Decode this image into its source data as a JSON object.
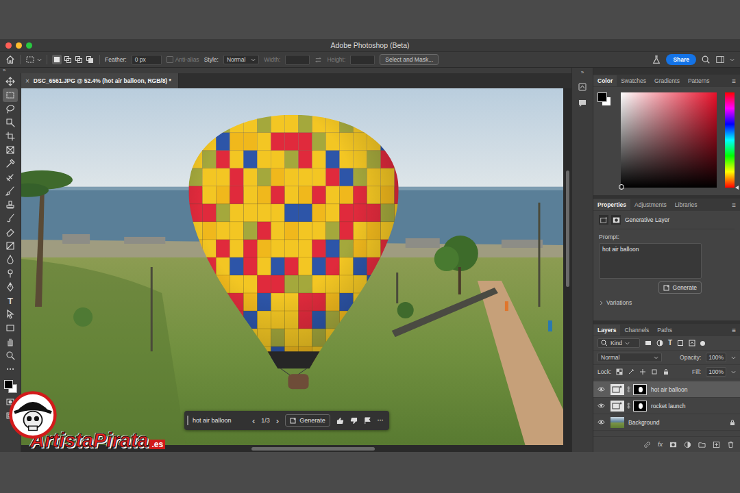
{
  "window": {
    "title": "Adobe Photoshop (Beta)"
  },
  "options_bar": {
    "feather_label": "Feather:",
    "feather_value": "0 px",
    "anti_alias": {
      "label": "Anti-alias",
      "checked": false,
      "disabled": true
    },
    "style_label": "Style:",
    "style_value": "Normal",
    "width_label": "Width:",
    "height_label": "Height:",
    "size_disabled": true,
    "select_and_mask": "Select and Mask...",
    "share": "Share",
    "selection_modes": [
      {
        "selected": true
      },
      {
        "selected": false
      },
      {
        "selected": false
      },
      {
        "selected": false
      }
    ]
  },
  "panel_collapse": "»",
  "panel_menu": "≡",
  "document": {
    "tab_title": "DSC_6561.JPG @ 52.4% (hot air balloon, RGB/8) *",
    "close": "×"
  },
  "tools": [
    {
      "selected": false
    },
    {
      "selected": true
    },
    {
      "selected": false
    },
    {
      "selected": false
    },
    {
      "selected": false
    },
    {
      "selected": false
    },
    {
      "selected": false
    },
    {
      "selected": false
    },
    {
      "selected": false
    },
    {
      "selected": false
    },
    {
      "selected": false
    },
    {
      "selected": false
    },
    {
      "selected": false
    },
    {
      "selected": false
    },
    {
      "selected": false
    },
    {
      "selected": false
    },
    {
      "selected": false,
      "glyph": "T"
    },
    {
      "selected": false
    },
    {
      "selected": false
    },
    {
      "selected": false
    },
    {
      "selected": false
    },
    {
      "selected": false
    }
  ],
  "task_bar": {
    "prompt": "hot air balloon",
    "prev": "‹",
    "counter": "1/3",
    "next": "›",
    "generate": "Generate",
    "more": "···"
  },
  "color_panel": {
    "tabs": [
      {
        "label": "Color",
        "selected": true
      },
      {
        "label": "Swatches",
        "selected": false
      },
      {
        "label": "Gradients",
        "selected": false
      },
      {
        "label": "Patterns",
        "selected": false
      }
    ]
  },
  "properties": {
    "tabs": [
      {
        "label": "Properties",
        "selected": true
      },
      {
        "label": "Adjustments",
        "selected": false
      },
      {
        "label": "Libraries",
        "selected": false
      }
    ],
    "layer_type": "Generative Layer",
    "prompt_label": "Prompt:",
    "prompt": "hot air balloon",
    "generate": "Generate",
    "variations": {
      "label": "Variations",
      "expanded": false
    }
  },
  "layers": {
    "tabs": [
      {
        "label": "Layers",
        "selected": true
      },
      {
        "label": "Channels",
        "selected": false
      },
      {
        "label": "Paths",
        "selected": false
      }
    ],
    "filter": "Kind",
    "type_filter_glyph": "T",
    "blend_mode": "Normal",
    "opacity_label": "Opacity:",
    "opacity": "100%",
    "lock_label": "Lock:",
    "fill_label": "Fill:",
    "fill": "100%",
    "fx": "fx",
    "items": [
      {
        "name": "hot air balloon",
        "selected": true,
        "visible": true,
        "locked": false,
        "kind": "generative"
      },
      {
        "name": "rocket launch",
        "selected": false,
        "visible": true,
        "locked": false,
        "kind": "generative"
      },
      {
        "name": "Background",
        "selected": false,
        "visible": true,
        "locked": true,
        "kind": "image"
      }
    ]
  },
  "watermark": {
    "text": "ArtistaPirata",
    "suffix": ".es"
  }
}
